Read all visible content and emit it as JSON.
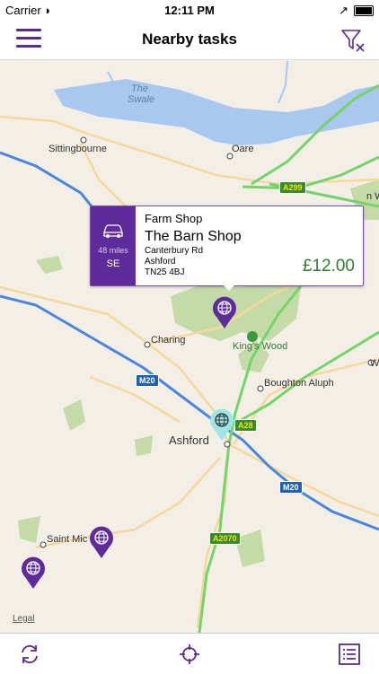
{
  "status_bar": {
    "carrier": "Carrier",
    "time": "12:11 PM"
  },
  "nav": {
    "title": "Nearby tasks",
    "menu_icon": "hamburger-menu-icon",
    "filter_icon": "filter-clear-icon"
  },
  "map": {
    "labels": {
      "swale_1": "The",
      "swale_2": "Swale",
      "sittingbourne": "Sittingbourne",
      "oare": "Oare",
      "charing": "Charing",
      "kings_wood": "King's Wood",
      "boughton_aluph": "Boughton Aluph",
      "ashford": "Ashford",
      "saint_mic": "Saint Mic",
      "edge_w": "W",
      "edge_nw": "n W"
    },
    "road_signs": {
      "a299": "A299",
      "a28": "A28",
      "m20_west": "M20",
      "m20_east": "M20",
      "a2070": "A2070"
    },
    "legal": "Legal"
  },
  "callout": {
    "category": "Farm Shop",
    "name": "The Barn Shop",
    "address_line1": "Canterbury Rd",
    "address_line2": "Ashford",
    "postcode": "TN25 4BJ",
    "distance": "48 miles",
    "direction": "SE",
    "price": "£12.00",
    "transport_icon": "car-icon"
  },
  "toolbar": {
    "refresh_icon": "refresh-icon",
    "locate_icon": "crosshair-icon",
    "list_icon": "list-icon"
  },
  "colors": {
    "brand_purple": "#5d2b9a",
    "price_green": "#2e7d32",
    "motorway_blue": "#3d7bd8",
    "a_road_green": "#6fd25f"
  }
}
